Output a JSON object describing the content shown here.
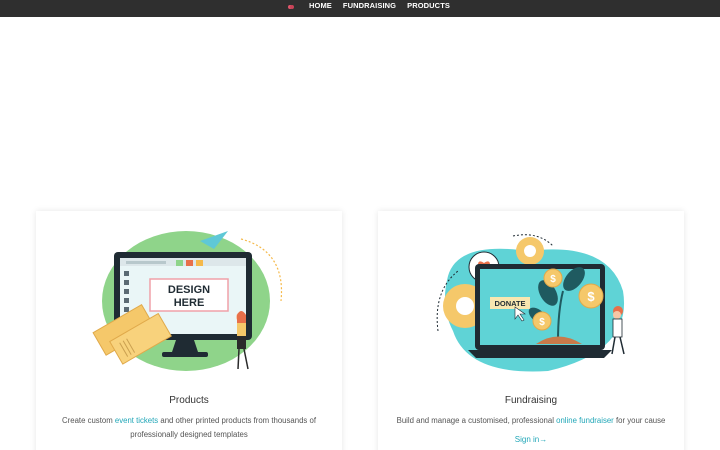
{
  "nav": {
    "items": [
      "HOME",
      "FUNDRAISING",
      "PRODUCTS"
    ]
  },
  "products_card": {
    "title": "Products",
    "desc_before": "Create custom ",
    "desc_link": "event tickets",
    "desc_after": " and other printed products from thousands of professionally designed templates",
    "illustration_text": "DESIGN HERE"
  },
  "fundraising_card": {
    "title": "Fundraising",
    "desc_before": "Build and manage a customised, professional ",
    "desc_link": "online fundraiser",
    "desc_after": " for your cause",
    "signin_label": "Sign in→",
    "illustration_button": "DONATE"
  },
  "colors": {
    "topbar": "#2f2f2f",
    "accent_teal": "#22a7b8",
    "green_blob": "#8fd48a",
    "ticket_yellow": "#f5c86a",
    "screen_teal": "#5fd3d6"
  },
  "icons": {
    "logo": "heart-logo-icon"
  }
}
